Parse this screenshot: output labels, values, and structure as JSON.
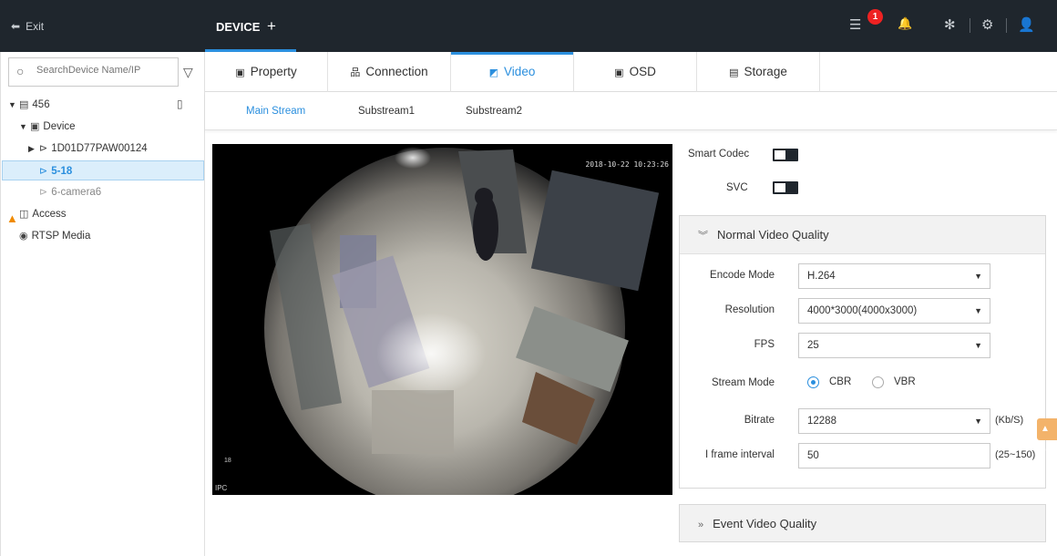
{
  "topbar": {
    "exit_label": "Exit",
    "device_tab_label": "DEVICE",
    "add_tab": "+",
    "alarm_badge": "1"
  },
  "sidebar": {
    "search_placeholder": "SearchDevice Name/IP",
    "tree": {
      "root": "456",
      "device_group": "Device",
      "device1": "1D01D77PAW00124",
      "device2": "5-18",
      "device3": "6-camera6",
      "access": "Access",
      "rtsp": "RTSP Media"
    }
  },
  "tabs": {
    "property": "Property",
    "connection": "Connection",
    "video": "Video",
    "osd": "OSD",
    "storage": "Storage"
  },
  "subtabs": {
    "main": "Main Stream",
    "sub1": "Substream1",
    "sub2": "Substream2"
  },
  "video": {
    "timestamp": "2018-10-22 10:23:26",
    "overlay_label": "IPC",
    "overlay_number": "18"
  },
  "settings": {
    "smart_codec_label": "Smart Codec",
    "svc_label": "SVC",
    "normal_section": "Normal Video Quality",
    "event_section": "Event Video Quality",
    "encode_mode_label": "Encode Mode",
    "encode_mode_value": "H.264",
    "resolution_label": "Resolution",
    "resolution_value": "4000*3000(4000x3000)",
    "fps_label": "FPS",
    "fps_value": "25",
    "stream_mode_label": "Stream Mode",
    "stream_cbr": "CBR",
    "stream_vbr": "VBR",
    "bitrate_label": "Bitrate",
    "bitrate_value": "12288",
    "bitrate_unit": "(Kb/S)",
    "iframe_label": "I frame interval",
    "iframe_value": "50",
    "iframe_range": "(25~150)"
  },
  "floating_warning": "0",
  "colors": {
    "accent": "#2b8fde",
    "topbar": "#1f262d",
    "warning": "#f08a00"
  }
}
